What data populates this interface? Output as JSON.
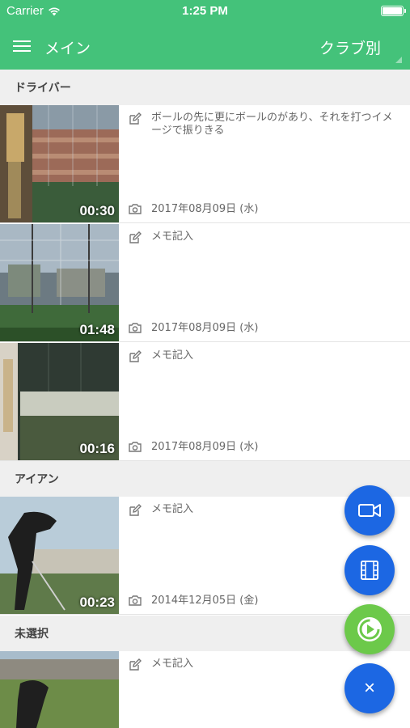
{
  "status_bar": {
    "carrier": "Carrier",
    "time": "1:25 PM",
    "battery_level": 1.0
  },
  "nav": {
    "title": "メイン",
    "club_selector": "クラブ別"
  },
  "sections": [
    {
      "label": "ドライバー",
      "items": [
        {
          "duration": "00:30",
          "memo": "ボールの先に更にボールのがあり、それを打つイメージで振りきる",
          "date": "2017年08月09日 (水)"
        },
        {
          "duration": "01:48",
          "memo": "メモ記入",
          "date": "2017年08月09日 (水)"
        },
        {
          "duration": "00:16",
          "memo": "メモ記入",
          "date": "2017年08月09日 (水)"
        }
      ]
    },
    {
      "label": "アイアン",
      "items": [
        {
          "duration": "00:23",
          "memo": "メモ記入",
          "date": "2014年12月05日 (金)"
        }
      ]
    },
    {
      "label": "未選択",
      "items": [
        {
          "duration": "",
          "memo": "メモ記入",
          "date": ""
        }
      ]
    }
  ],
  "fabs": [
    {
      "name": "record-video",
      "icon": "video-camera-icon",
      "color": "#1c67e3"
    },
    {
      "name": "video-library",
      "icon": "film-icon",
      "color": "#1c67e3"
    },
    {
      "name": "play-app",
      "icon": "play-circle-icon",
      "color": "#6cc94a"
    },
    {
      "name": "close-menu",
      "icon": "close-icon",
      "label": "×",
      "color": "#1c67e3"
    }
  ],
  "colors": {
    "accent": "#44c27a",
    "fab_blue": "#1c67e3",
    "fab_green": "#6cc94a"
  }
}
